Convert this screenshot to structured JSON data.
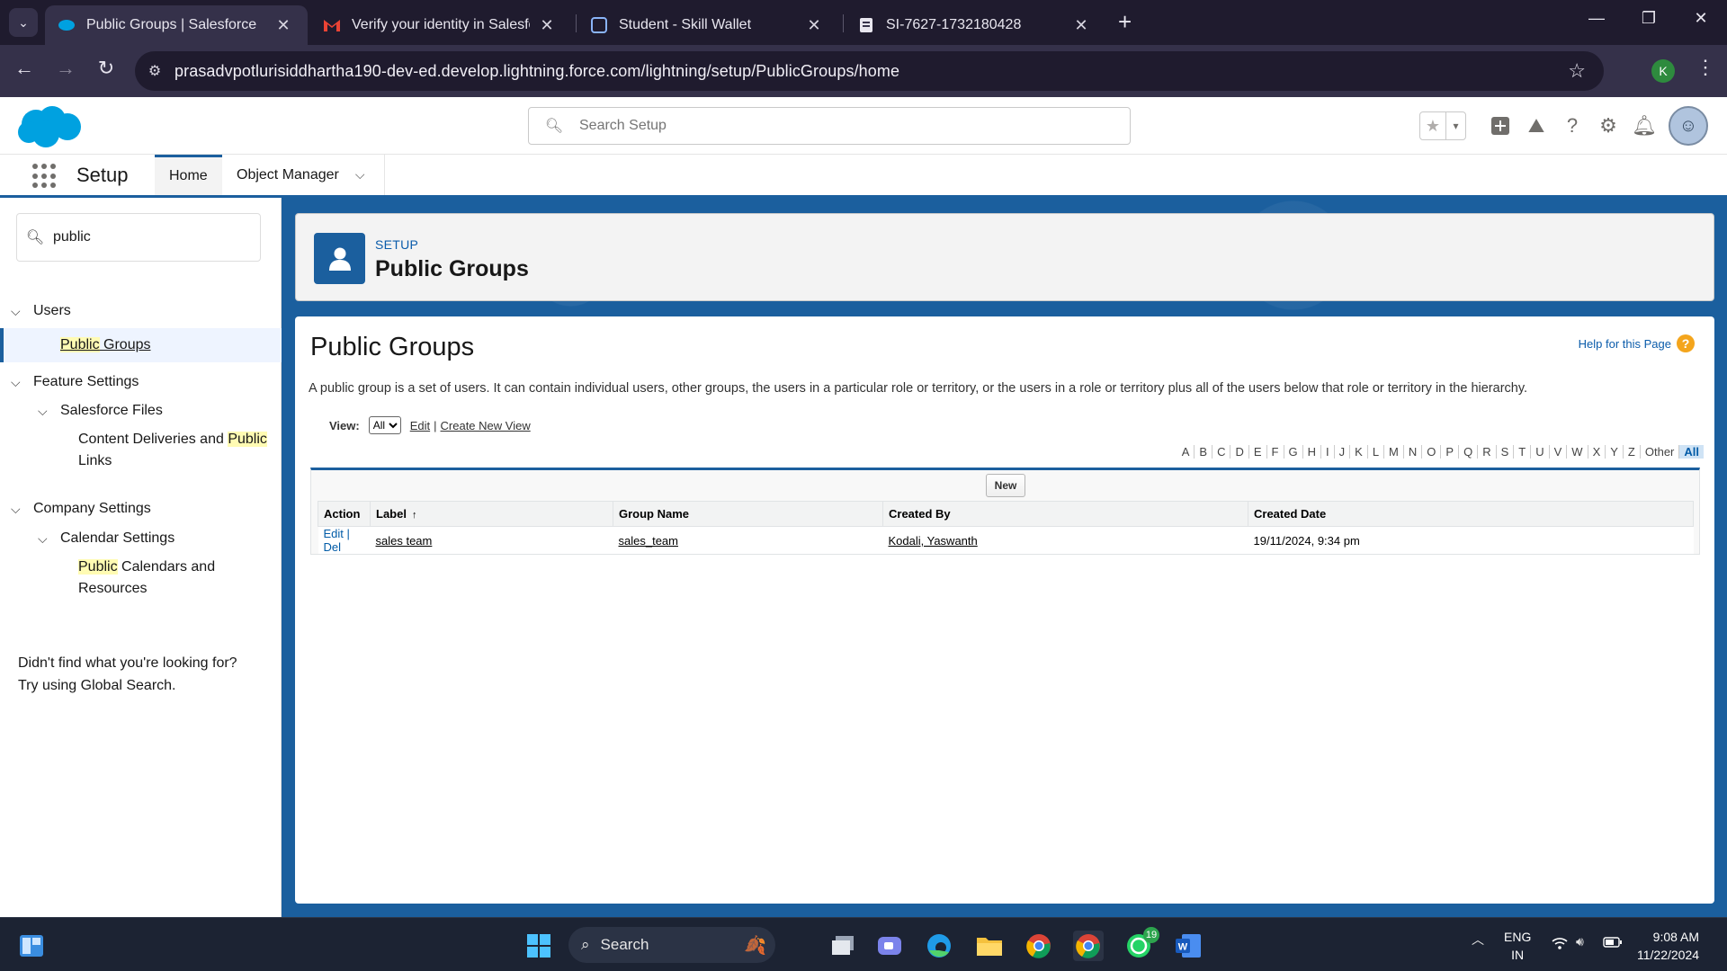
{
  "browser": {
    "tabs": [
      {
        "title": "Public Groups | Salesforce",
        "active": true,
        "icon": "salesforce-cloud-icon"
      },
      {
        "title": "Verify your identity in Salesforce",
        "active": false,
        "icon": "gmail-icon"
      },
      {
        "title": "Student - Skill Wallet",
        "active": false,
        "icon": "skill-wallet-icon"
      },
      {
        "title": "SI-7627-1732180428",
        "active": false,
        "icon": "document-icon"
      }
    ],
    "url": "prasadvpotlurisiddhartha190-dev-ed.develop.lightning.force.com/lightning/setup/PublicGroups/home",
    "profile_initial": "K"
  },
  "sf_header": {
    "search_placeholder": "Search Setup",
    "app_name": "Setup",
    "nav_tabs": [
      {
        "label": "Home",
        "active": true
      },
      {
        "label": "Object Manager",
        "active": false
      }
    ]
  },
  "sidebar": {
    "quick_find_value": "public",
    "tree": {
      "users": "Users",
      "public_groups_hl": "Public",
      "public_groups_rest": " Groups",
      "feature_settings": "Feature Settings",
      "salesforce_files": "Salesforce Files",
      "content_deliveries_pre": "Content Deliveries and ",
      "content_deliveries_hl": "Public",
      "content_deliveries_post": "Links",
      "company_settings": "Company Settings",
      "calendar_settings": "Calendar Settings",
      "public_calendars_hl": "Public",
      "public_calendars_rest": " Calendars and",
      "public_calendars_post": "Resources"
    },
    "not_found_line1": "Didn't find what you're looking for?",
    "not_found_line2": "Try using Global Search."
  },
  "page_header": {
    "eyebrow": "SETUP",
    "title": "Public Groups"
  },
  "content": {
    "title": "Public Groups",
    "help_link": "Help for this Page",
    "description": "A public group is a set of users. It can contain individual users, other groups, the users in a particular role or territory, or the users in a role or territory plus all of the users below that role or territory in the hierarchy.",
    "view_label": "View:",
    "view_selected": "All",
    "edit_link": "Edit",
    "create_view_link": "Create New View",
    "alphabet": [
      "A",
      "B",
      "C",
      "D",
      "E",
      "F",
      "G",
      "H",
      "I",
      "J",
      "K",
      "L",
      "M",
      "N",
      "O",
      "P",
      "Q",
      "R",
      "S",
      "T",
      "U",
      "V",
      "W",
      "X",
      "Y",
      "Z",
      "Other",
      "All"
    ],
    "new_button": "New",
    "columns": [
      "Action",
      "Label",
      "Group Name",
      "Created By",
      "Created Date"
    ],
    "rows": [
      {
        "edit": "Edit",
        "del": "Del",
        "label": "sales team",
        "group_name": "sales_team",
        "created_by": "Kodali, Yaswanth",
        "created_date": "19/11/2024, 9:34 pm"
      }
    ]
  },
  "taskbar": {
    "search_label": "Search",
    "lang_line1": "ENG",
    "lang_line2": "IN",
    "time": "9:08 AM",
    "date": "11/22/2024",
    "whatsapp_badge": "19"
  },
  "colors": {
    "salesforce_blue": "#1b5f9e",
    "link_blue": "#0b5cab",
    "highlight_yellow": "#fffbb3"
  }
}
